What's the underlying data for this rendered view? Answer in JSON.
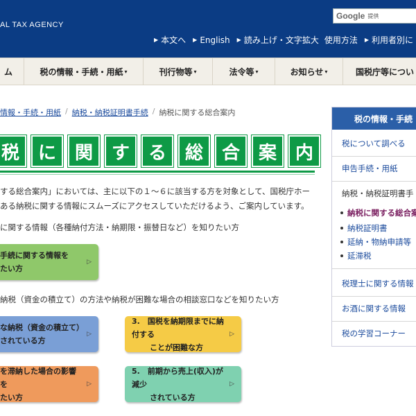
{
  "header": {
    "agency": "AL TAX AGENCY",
    "google_logo": "Google",
    "google_sub": "提供",
    "toplinks": [
      "本文へ",
      "English",
      "読み上げ・文字拡大",
      "使用方法",
      "利用者別に"
    ]
  },
  "nav": [
    "ム",
    "税の情報・手続・用紙",
    "刊行物等",
    "法令等",
    "お知らせ",
    "国税庁等につい"
  ],
  "breadcrumb": {
    "item1": "情報・手続・用紙",
    "item2": "納税・納税証明書手続",
    "current": "納税に関する総合案内",
    "sep": "/"
  },
  "title_chars": [
    "税",
    "に",
    "関",
    "す",
    "る",
    "総",
    "合",
    "案",
    "内"
  ],
  "intro": {
    "line1": "する総合案内」においては、主に以下の１～６に該当する方を対象として、国税庁ホー",
    "line2": "ある納税に関する情報にスムーズにアクセスしていただけるよう、ご案内しています。"
  },
  "question1": "に関する情報（各種納付方法・納期限・振替日など）を知りたい方",
  "question2": "納税（資金の積立て）の方法や納税が困難な場合の相談窓口などを知りたい方",
  "cards": {
    "c1": {
      "line1": "手続に関する情報を",
      "line2": "たい方"
    },
    "c2": {
      "line1": "な納税（資金の積立て）",
      "line2": "されている方"
    },
    "c3": {
      "line1": "3.　国税を納期限までに納付する",
      "line2": "ことが困難な方"
    },
    "c4": {
      "line1": "を滞納した場合の影響を",
      "line2": "たい方"
    },
    "c5": {
      "line1": "5.　前期から売上(収入)が減少",
      "line2": "されている方"
    },
    "arrow": "▷"
  },
  "sidebar": {
    "heading": "税の情報・手続",
    "items": [
      "税について調べる",
      "申告手続・用紙",
      "納税・納税証明書手",
      "税理士に関する情報",
      "お酒に関する情報",
      "税の学習コーナー"
    ],
    "subitems": [
      "納税に関する総合案",
      "納税証明書",
      "延納・物納申請等",
      "延滞税"
    ]
  },
  "colors": {
    "header_bg": "#0b3c84",
    "title_green": "#0e9a46",
    "sidebar_head": "#2b5fa8"
  }
}
